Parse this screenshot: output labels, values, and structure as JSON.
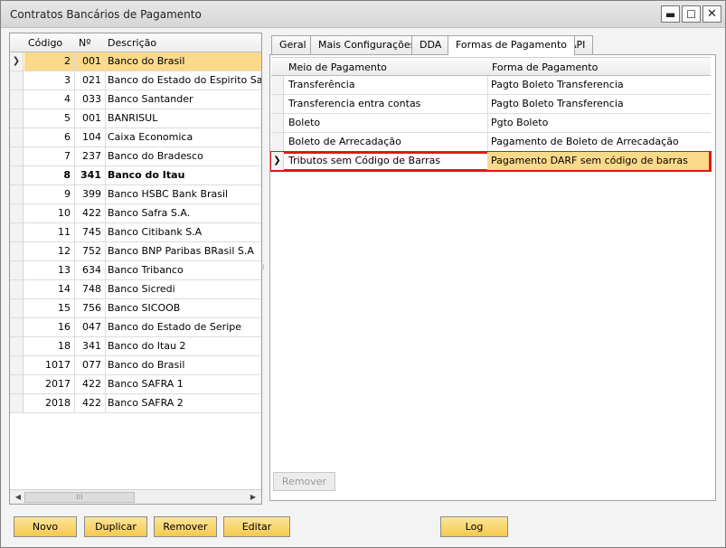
{
  "window": {
    "title": "Contratos Bancários de Pagamento"
  },
  "window_controls": {
    "minimize": "▬",
    "maximize": "☐",
    "close": "✕"
  },
  "left_grid": {
    "columns": [
      "Código",
      "Nº",
      "Descrição"
    ],
    "rows": [
      {
        "codigo": "2",
        "num": "001",
        "descricao": "Banco do Brasil"
      },
      {
        "codigo": "3",
        "num": "021",
        "descricao": "Banco do Estado  do Espirito Santo"
      },
      {
        "codigo": "4",
        "num": "033",
        "descricao": "Banco Santander"
      },
      {
        "codigo": "5",
        "num": "001",
        "descricao": "BANRISUL"
      },
      {
        "codigo": "6",
        "num": "104",
        "descricao": "Caixa Economica"
      },
      {
        "codigo": "7",
        "num": "237",
        "descricao": "Banco do Bradesco"
      },
      {
        "codigo": "8",
        "num": "341",
        "descricao": "Banco do Itau"
      },
      {
        "codigo": "9",
        "num": "399",
        "descricao": "Banco HSBC Bank Brasil"
      },
      {
        "codigo": "10",
        "num": "422",
        "descricao": "Banco Safra S.A."
      },
      {
        "codigo": "11",
        "num": "745",
        "descricao": "Banco Citibank S.A"
      },
      {
        "codigo": "12",
        "num": "752",
        "descricao": "Banco BNP Paribas BRasil S.A"
      },
      {
        "codigo": "13",
        "num": "634",
        "descricao": "Banco Tribanco"
      },
      {
        "codigo": "14",
        "num": "748",
        "descricao": "Banco Sicredi"
      },
      {
        "codigo": "15",
        "num": "756",
        "descricao": "Banco SICOOB"
      },
      {
        "codigo": "16",
        "num": "047",
        "descricao": "Banco do Estado de Seripe"
      },
      {
        "codigo": "18",
        "num": "341",
        "descricao": "Banco do Itau 2"
      },
      {
        "codigo": "1017",
        "num": "077",
        "descricao": "Banco do Brasil"
      },
      {
        "codigo": "2017",
        "num": "422",
        "descricao": "Banco SAFRA 1"
      },
      {
        "codigo": "2018",
        "num": "422",
        "descricao": "Banco SAFRA 2"
      }
    ],
    "selected_row_marker": "❯",
    "scroll_left": "◀",
    "scroll_right": "▶",
    "scroll_grip": "⁞⁞⁞"
  },
  "tabs": [
    {
      "label": "Geral"
    },
    {
      "label": "Mais Configurações"
    },
    {
      "label": "DDA"
    },
    {
      "label": "Formas de Pagamento"
    },
    {
      "label": "API"
    }
  ],
  "payment_grid": {
    "columns": [
      "Meio de Pagamento",
      "Forma de Pagamento"
    ],
    "rows": [
      {
        "meio": "Transferência",
        "forma": "Pagto Boleto Transferencia"
      },
      {
        "meio": "Transferencia entra contas",
        "forma": "Pagto Boleto Transferencia"
      },
      {
        "meio": "Boleto",
        "forma": "Pgto Boleto"
      },
      {
        "meio": "Boleto de Arrecadação",
        "forma": "Pagamento de Boleto de Arrecadação"
      },
      {
        "meio": "Tributos sem Código de Barras",
        "forma": "Pagamento DARF sem código de barras"
      }
    ],
    "selected_row_marker": "❯",
    "remove_label": "Remover"
  },
  "splitter_grip": "⁞",
  "footer": {
    "novo": "Novo",
    "duplicar": "Duplicar",
    "remover": "Remover",
    "editar": "Editar",
    "log": "Log"
  },
  "colors": {
    "selection": "#fbd98a",
    "highlight_box": "#e0161b",
    "button": "#f5c94d"
  }
}
